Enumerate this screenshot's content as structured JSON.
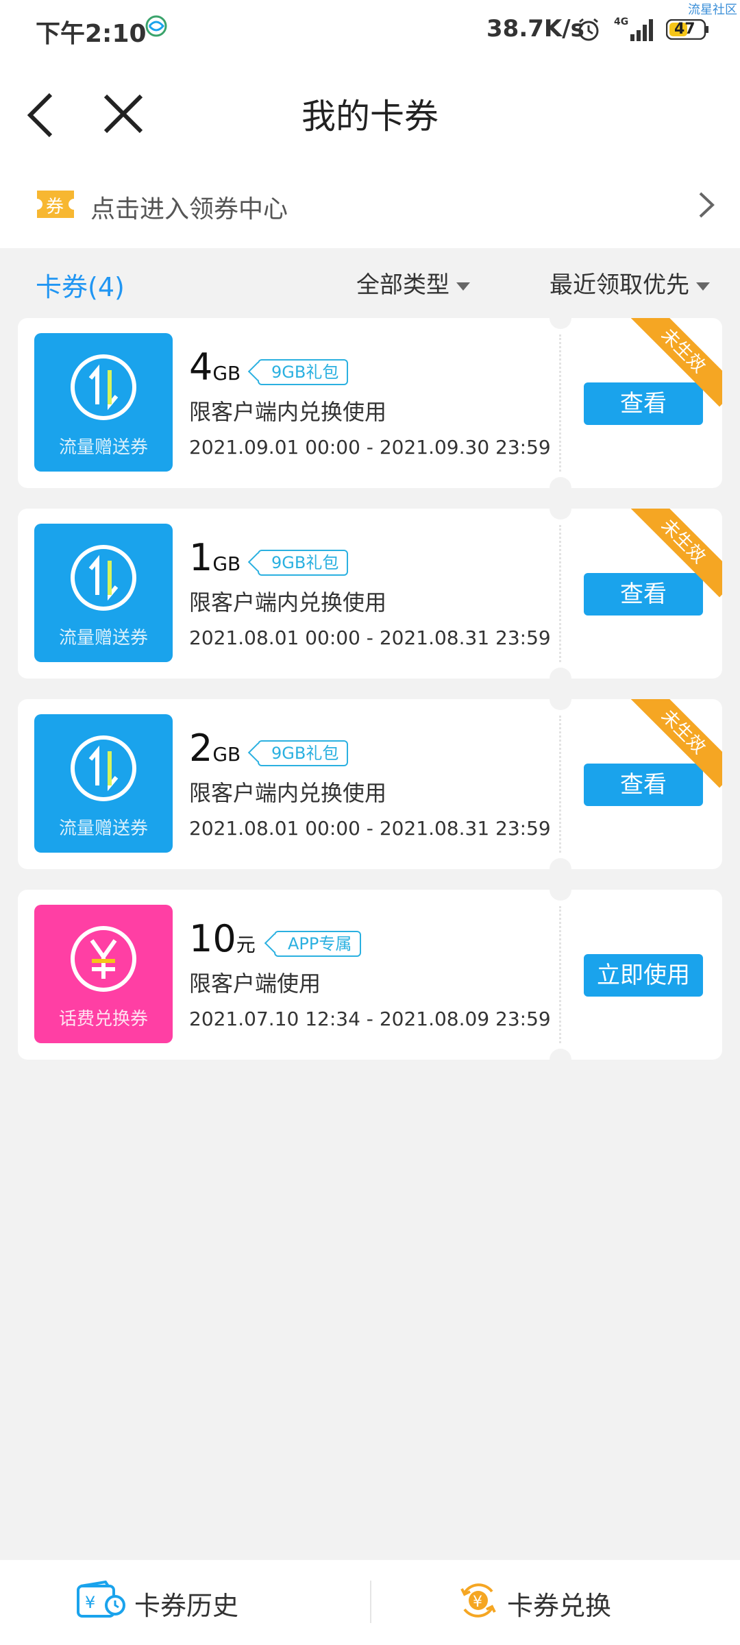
{
  "status_bar": {
    "time": "下午2:10",
    "speed": "38.7K/s",
    "network": "4G",
    "battery": "47",
    "watermark": "流星社区"
  },
  "nav": {
    "title": "我的卡券"
  },
  "coupon_center": {
    "icon_char": "券",
    "label": "点击进入领券中心"
  },
  "filter": {
    "count_label": "卡券(4)",
    "type_label": "全部类型",
    "sort_label": "最近领取优先"
  },
  "coupons": [
    {
      "icon_label": "流量赠送券",
      "amount": "4",
      "unit": "GB",
      "tag": "9GB礼包",
      "desc": "限客户端内兑换使用",
      "date": "2021.09.01 00:00 - 2021.09.30 23:59",
      "button": "查看",
      "ribbon": "未生效"
    },
    {
      "icon_label": "流量赠送券",
      "amount": "1",
      "unit": "GB",
      "tag": "9GB礼包",
      "desc": "限客户端内兑换使用",
      "date": "2021.08.01 00:00 - 2021.08.31 23:59",
      "button": "查看",
      "ribbon": "未生效"
    },
    {
      "icon_label": "流量赠送券",
      "amount": "2",
      "unit": "GB",
      "tag": "9GB礼包",
      "desc": "限客户端内兑换使用",
      "date": "2021.08.01 00:00 - 2021.08.31 23:59",
      "button": "查看",
      "ribbon": "未生效"
    },
    {
      "icon_label": "话费兑换券",
      "amount": "10",
      "unit": "元",
      "tag": "APP专属",
      "desc": "限客户端使用",
      "date": "2021.07.10 12:34 - 2021.08.09 23:59",
      "button": "立即使用"
    }
  ],
  "bottom": {
    "history_label": "卡券历史",
    "exchange_label": "卡券兑换"
  },
  "colors": {
    "accent": "#1aa3ec",
    "pink": "#ff3fa4",
    "ribbon": "#f5a623"
  }
}
